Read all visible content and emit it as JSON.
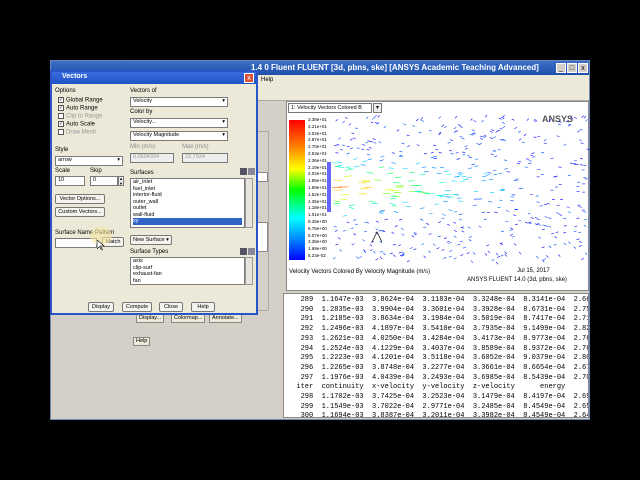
{
  "main_window": {
    "title": "[ANSYS Academic Teaching Advanced]",
    "title_prefix": "1.4 0 Fluent FLUENT [3d, pbns, ske]",
    "menu_help": "Help"
  },
  "graphics": {
    "dropdown": "1: Velocity Vectors Colored B",
    "legend_values": [
      "3.38e+01",
      "3.21e+01",
      "3.04e+01",
      "2.87e+01",
      "2.70e+01",
      "2.53e+01",
      "2.36e+01",
      "2.19e+01",
      "2.02e+01",
      "1.85e+01",
      "1.69e+01",
      "1.52e+01",
      "1.35e+01",
      "1.18e+01",
      "1.01e+01",
      "8.45e+00",
      "6.76e+00",
      "5.07e+00",
      "3.38e+00",
      "1.69e+00",
      "5.23e-02"
    ],
    "caption": "Velocity Vectors Colored By Velocity Magnitude (m/s)",
    "date": "Jul 15, 2017",
    "version": "ANSYS FLUENT 14.0 (3d, pbns, ske)",
    "logo": "ANSYS"
  },
  "console": {
    "lines": [
      "   289  1.1647e-03  3.8624e-04  3.1183e-04  3.3248e-04  8.3141e-04  2.6620e",
      "   290  1.2835e-03  3.9904e-04  3.3601e-04  3.3928e-04  8.6731e-04  2.7557e",
      "   291  1.2185e-03  3.8634e-04  3.1984e-04  3.5019e-04  8.7417e-04  2.7171e",
      "   292  1.2496e-03  4.1897e-04  3.5410e-04  3.7935e-04  9.1499e-04  2.8242e",
      "   293  1.2621e-03  4.0250e-04  3.4284e-04  3.4173e-04  8.9773e-04  2.7696e",
      "   294  1.2524e-03  4.1229e-04  3.4037e-04  3.8589e-04  8.9372e-04  2.7656e",
      "   295  1.2223e-03  4.1201e-04  3.5118e-04  3.6052e-04  9.0379e-04  2.8022e",
      "   296  1.2265e-03  3.8748e-04  3.2277e-04  3.3661e-04  8.6654e-04  2.6733e",
      "   297  1.1976e-03  4.0439e-04  3.2493e-04  3.6985e-04  8.5439e-04  2.7060e",
      "  iter  continuity  x-velocity  y-velocity  z-velocity      energy",
      "   298  1.1702e-03  3.7425e-04  3.2523e-04  3.1479e-04  8.4197e-04  2.6964e",
      "   299  1.1549e-03  3.7022e-04  2.9771e-04  3.2485e-04  8.4549e-04  2.6546e",
      "   300  1.1694e-03  3.8387e-04  3.2011e-04  3.3982e-04  8.4549e-04  2.6484e"
    ]
  },
  "main_buttons": {
    "display": "Display...",
    "colormap": "Colormap...",
    "annotate": "Annotate...",
    "help": "Help"
  },
  "dialog": {
    "title": "Vectors",
    "close": "x",
    "options_label": "Options",
    "options": [
      {
        "label": "Global Range",
        "checked": true
      },
      {
        "label": "Auto Range",
        "checked": true
      },
      {
        "label": "Clip to Range",
        "checked": false
      },
      {
        "label": "Auto Scale",
        "checked": true
      },
      {
        "label": "Draw Mesh",
        "checked": false
      }
    ],
    "vectors_of_label": "Vectors of",
    "vectors_of_value": "Velocity",
    "color_by_label": "Color by",
    "color_by_value": "Velocity...",
    "color_by_sub": "Velocity Magnitude",
    "min_label": "Min (m/s)",
    "max_label": "Max (m/s)",
    "min_value": "0.0604394",
    "max_value": "33.7934",
    "style_label": "Style",
    "style_value": "arrow",
    "scale_label": "Scale",
    "scale_value": "10",
    "skip_label": "Skip",
    "skip_value": "0",
    "vector_options": "Vector Options...",
    "custom_vectors": "Custom Vectors...",
    "surfaces_label": "Surfaces",
    "surfaces": [
      "air_inlet",
      "fuel_inlet",
      "interior-fluid",
      "outer_wall",
      "outlet",
      "wall-fluid",
      "xy"
    ],
    "selected_surface": "xy",
    "surface_name_pattern_label": "Surface Name Pattern",
    "match_button": "Match",
    "new_surface": "New Surface",
    "surface_types_label": "Surface Types",
    "surface_types": [
      "axis",
      "clip-surf",
      "exhaust-fan",
      "fan"
    ],
    "display_button": "Display",
    "compute_button": "Compute",
    "close_button": "Close",
    "help_button": "Help"
  },
  "colors": {
    "title_blue": "#1f52c5",
    "selection": "#3163c5",
    "highlight": "#f3e6a0"
  }
}
